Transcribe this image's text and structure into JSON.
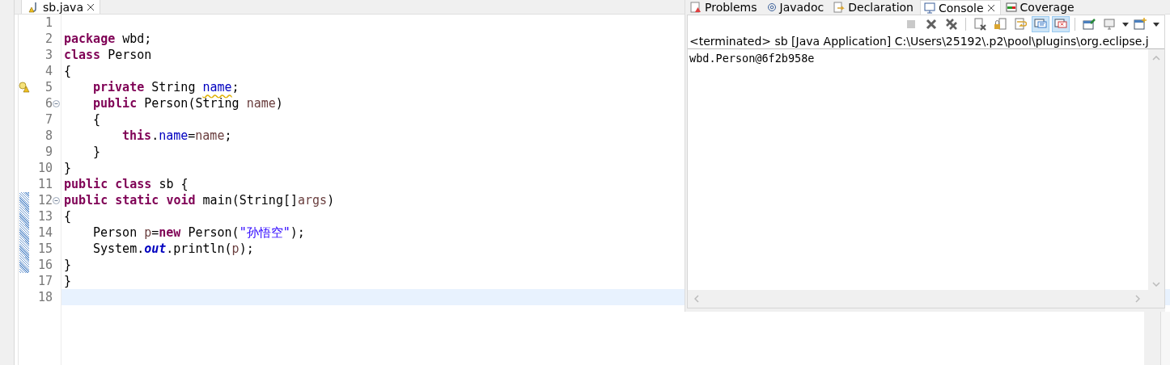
{
  "editor": {
    "tab": {
      "label": "sb.java",
      "selected": true
    },
    "lines": [
      {
        "number": "1"
      },
      {
        "number": "2",
        "tokens": [
          {
            "kind": "keyword",
            "text": "package"
          },
          {
            "kind": "plain",
            "text": " wbd;"
          }
        ]
      },
      {
        "number": "3",
        "tokens": [
          {
            "kind": "keyword",
            "text": "class"
          },
          {
            "kind": "plain",
            "text": " Person"
          }
        ]
      },
      {
        "number": "4",
        "tokens": [
          {
            "kind": "plain",
            "text": "{"
          }
        ],
        "children": [
          {
            "number": "5",
            "warning": true,
            "tokens": [
              {
                "kind": "keyword",
                "text": "private"
              },
              {
                "kind": "plain",
                "text": " String "
              },
              {
                "kind": "field",
                "text": "name",
                "warning": true
              },
              {
                "kind": "plain",
                "text": ";"
              }
            ]
          },
          {
            "number": "6",
            "fold": {
              "expanded": true
            },
            "tokens": [
              {
                "kind": "keyword",
                "text": "public"
              },
              {
                "kind": "plain",
                "text": " Person(String "
              },
              {
                "kind": "local",
                "text": "name"
              },
              {
                "kind": "plain",
                "text": ")"
              }
            ]
          },
          {
            "number": "7",
            "tokens": [
              {
                "kind": "plain",
                "text": "{"
              }
            ],
            "children": [
              {
                "number": "8",
                "tokens": [
                  {
                    "kind": "keyword",
                    "text": "this"
                  },
                  {
                    "kind": "plain",
                    "text": "."
                  },
                  {
                    "kind": "field",
                    "text": "name"
                  },
                  {
                    "kind": "plain",
                    "text": "="
                  },
                  {
                    "kind": "local",
                    "text": "name"
                  },
                  {
                    "kind": "plain",
                    "text": ";"
                  }
                ]
              }
            ]
          },
          {
            "number": "9",
            "tokens": [
              {
                "kind": "plain",
                "text": "}"
              }
            ]
          }
        ]
      },
      {
        "number": "10",
        "tokens": [
          {
            "kind": "plain",
            "text": "}"
          }
        ]
      },
      {
        "number": "11",
        "tokens": [
          {
            "kind": "keyword",
            "text": "public "
          },
          {
            "kind": "keyword",
            "text": "class"
          },
          {
            "kind": "plain",
            "text": " sb {"
          }
        ]
      },
      {
        "number": "12",
        "fold": {
          "expanded": true
        },
        "changed": true,
        "tokens": [
          {
            "kind": "keyword",
            "text": "public "
          },
          {
            "kind": "keyword",
            "text": "static "
          },
          {
            "kind": "keyword",
            "text": "void"
          },
          {
            "kind": "plain",
            "text": " main(String[]"
          },
          {
            "kind": "local",
            "text": "args"
          },
          {
            "kind": "plain",
            "text": ")"
          }
        ]
      },
      {
        "number": "13",
        "changed": true,
        "tokens": [
          {
            "kind": "plain",
            "text": "{"
          }
        ],
        "children": [
          {
            "number": "14",
            "changed": true,
            "tokens": [
              {
                "kind": "plain",
                "text": "Person "
              },
              {
                "kind": "local",
                "text": "p"
              },
              {
                "kind": "plain",
                "text": "="
              },
              {
                "kind": "keyword",
                "text": "new"
              },
              {
                "kind": "plain",
                "text": " Person("
              },
              {
                "kind": "string",
                "text": "\"孙悟空\""
              },
              {
                "kind": "plain",
                "text": ");"
              }
            ]
          },
          {
            "number": "15",
            "changed": true,
            "tokens": [
              {
                "kind": "plain",
                "text": "System."
              },
              {
                "kind": "static",
                "text": "out"
              },
              {
                "kind": "plain",
                "text": ".println("
              },
              {
                "kind": "local",
                "text": "p"
              },
              {
                "kind": "plain",
                "text": ");"
              }
            ]
          }
        ]
      },
      {
        "number": "16",
        "changed": true,
        "tokens": [
          {
            "kind": "plain",
            "text": "}"
          }
        ]
      },
      {
        "number": "17",
        "tokens": [
          {
            "kind": "plain",
            "text": "}"
          }
        ]
      },
      {
        "number": "18",
        "current": true
      }
    ]
  },
  "console": {
    "tabs": [
      {
        "label": "Problems",
        "selected": false
      },
      {
        "label": "Javadoc",
        "selected": false
      },
      {
        "label": "Declaration",
        "selected": false
      },
      {
        "label": "Console",
        "selected": true
      },
      {
        "label": "Coverage",
        "selected": false
      }
    ],
    "toolbar": [
      [
        {
          "disabled": true,
          "pressed": false
        },
        {
          "disabled": false,
          "pressed": false
        },
        {
          "disabled": false,
          "pressed": false
        }
      ],
      [
        {
          "disabled": false,
          "pressed": false
        },
        {
          "disabled": false,
          "pressed": false
        },
        {
          "disabled": false,
          "pressed": false
        },
        {
          "disabled": false,
          "pressed": true
        },
        {
          "disabled": false,
          "pressed": true
        }
      ],
      [
        {
          "disabled": false,
          "pressed": false
        },
        {
          "disabled": false,
          "pressed": false,
          "dropdown": true
        },
        {
          "disabled": false,
          "pressed": false,
          "dropdown": true
        }
      ]
    ],
    "status": "<terminated> sb [Java Application] C:\\Users\\25192\\.p2\\pool\\plugins\\org.eclipse.j",
    "output": [
      "wbd.Person@6f2b958e"
    ]
  }
}
